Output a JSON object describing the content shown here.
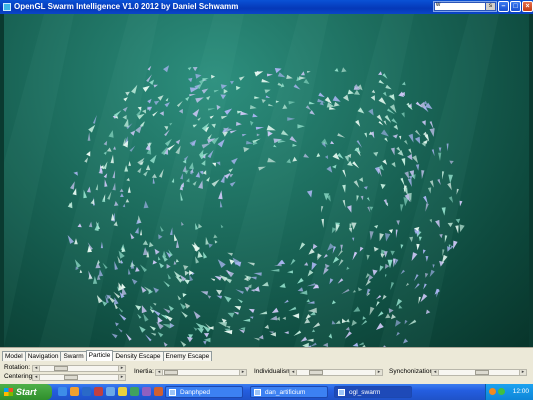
{
  "window": {
    "title": "OpenGL Swarm Intelligence V1.0 2012 by Daniel Schwamm",
    "mini_field": "w",
    "mini_button": "s"
  },
  "tabs": [
    {
      "label": "Model",
      "active": false
    },
    {
      "label": "Navigation",
      "active": false
    },
    {
      "label": "Swarm",
      "active": false
    },
    {
      "label": "Particle",
      "active": true
    },
    {
      "label": "Density Escape",
      "active": false
    },
    {
      "label": "Enemy Escape",
      "active": false
    }
  ],
  "controls": {
    "rotation": {
      "label": "Rotation:",
      "value": 0.22
    },
    "centering": {
      "label": "Centering:",
      "value": 0.38
    },
    "inertia": {
      "label": "Inertia:",
      "value": 0.03
    },
    "individualism": {
      "label": "Individualism:",
      "value": 0.19
    },
    "synchronization": {
      "label": "Synchonization:",
      "value": 0.55
    }
  },
  "taskbar": {
    "start_label": "Start",
    "tasks": [
      {
        "label": "Danphped",
        "active": false
      },
      {
        "label": "dan_artificium",
        "active": false
      },
      {
        "label": "ogl_swarm",
        "active": true
      }
    ],
    "time": "12:00"
  },
  "colors": {
    "water_light": "#2d8f7e",
    "water_dark": "#08352b",
    "fish_1": "#a8b4f0",
    "fish_2": "#c6f0e0",
    "fish_3": "#8fdcc8"
  }
}
